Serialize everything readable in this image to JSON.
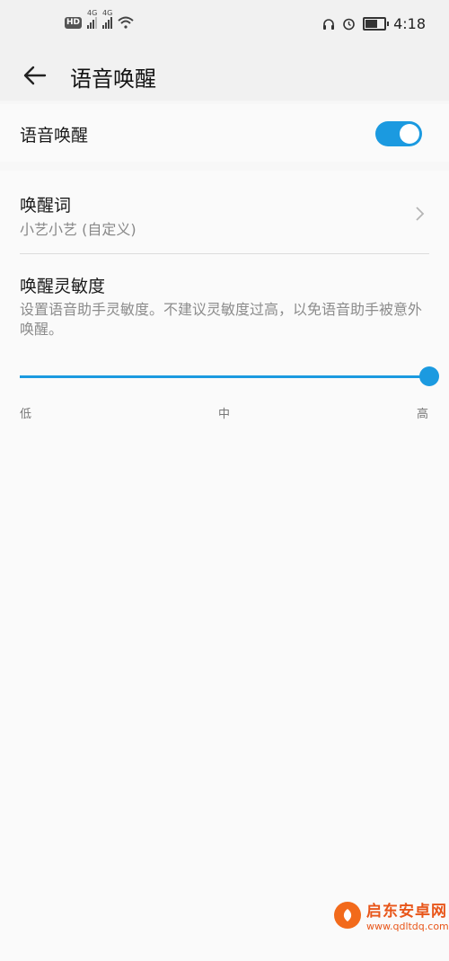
{
  "status_bar": {
    "hd": "HD",
    "sim1": "4G",
    "sim2": "4G",
    "time": "4:18",
    "battery_level": 0.7,
    "icons": [
      "hd-icon",
      "signal-icon",
      "signal-icon",
      "wifi-icon",
      "headset-icon",
      "alarm-icon",
      "battery-icon"
    ]
  },
  "header": {
    "title": "语音唤醒",
    "back_icon": "back-arrow-icon"
  },
  "voice_wake": {
    "label": "语音唤醒",
    "enabled": true
  },
  "wake_word": {
    "title": "唤醒词",
    "value": "小艺小艺 (自定义)",
    "chevron_icon": "chevron-right-icon"
  },
  "sensitivity": {
    "title": "唤醒灵敏度",
    "description": "设置语音助手灵敏度。不建议灵敏度过高，以免语音助手被意外唤醒。",
    "level": 1.0,
    "labels": {
      "low": "低",
      "mid": "中",
      "high": "高"
    }
  },
  "watermark": {
    "brand": "启东安卓网",
    "url": "www.qdltdq.com"
  },
  "colors": {
    "accent": "#1b9ae0",
    "watermark": "#e8561a"
  }
}
